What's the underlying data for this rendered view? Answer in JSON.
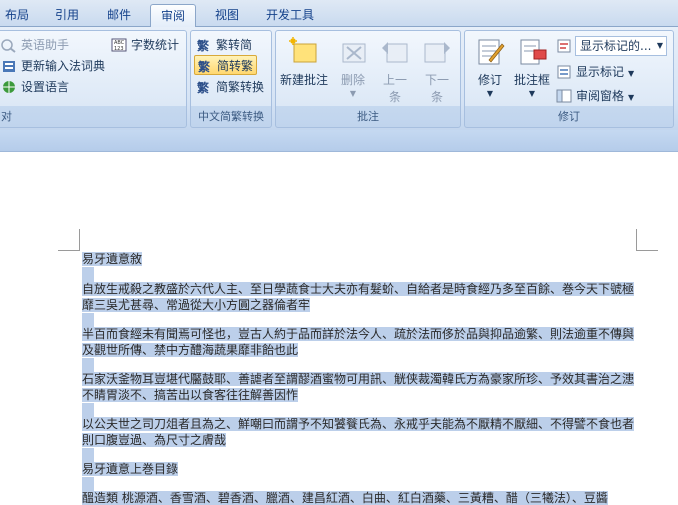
{
  "tabs": [
    {
      "label": "布局",
      "active": false
    },
    {
      "label": "引用",
      "active": false
    },
    {
      "label": "邮件",
      "active": false
    },
    {
      "label": "审阅",
      "active": true
    },
    {
      "label": "视图",
      "active": false
    },
    {
      "label": "开发工具",
      "active": false
    }
  ],
  "group_proofing": {
    "items": [
      "英语助手",
      "更新输入法词典",
      "设置语言"
    ],
    "word_count": "字数统计",
    "label": "对"
  },
  "group_chinese": {
    "items": [
      "繁转简",
      "简转繁",
      "简繁转换"
    ],
    "label": "中文简繁转换"
  },
  "group_comments": {
    "new_comment": "新建批注",
    "delete": "删除",
    "prev_1": "上一",
    "prev_2": "条",
    "next_1": "下一",
    "next_2": "条",
    "label": "批注"
  },
  "group_tracking": {
    "track": "修订",
    "balloons": "批注框",
    "display_dropdown": "显示标记的...",
    "show_markup": "显示标记",
    "review_pane": "审阅窗格",
    "label": "修订"
  },
  "document": {
    "lines": [
      "易牙遺意敘",
      "",
      "自放生戒殺之教盛於六代人主、至日學蔬食士大夫亦有髮蚧、自給者是時食經乃多至百餘、巻今天下號極",
      "靡三吳尤甚尋、常過從大小方圓之器倫者牢",
      "",
      "半百而食經未有聞焉可怪也，豈古人約于品而詳於法今人、疏於法而侈於品與抑品逾繁、則法逾重不傳與",
      "及觀世所傳、禁中方醴海蔬果靡非飴也此",
      "",
      "石家沃釜物耳豈堪代靨鼓耶、善謔者至謂醪酒蜜物可用訊、觥侠裁濁韓氏方為豪家所珍、予效其書治之漶",
      "不睛胃淡不、搞苦出以食客往往解善因怍",
      "",
      "以公夫世之司刀俎者且為之、鮮嘲曰而謂予不知饕餮氏為、永戒乎夫能為不厭精不厭細、不得譬不食也者",
      "則口腹豈過、為尺寸之膚哉",
      "",
      "易牙遺意上巻目錄",
      "",
      "醞造類 桃源酒、香雪酒、碧香酒、臘酒、建昌紅酒、白曲、紅白酒藥、三黃糟、醋（三犧法）、豆醬"
    ]
  }
}
